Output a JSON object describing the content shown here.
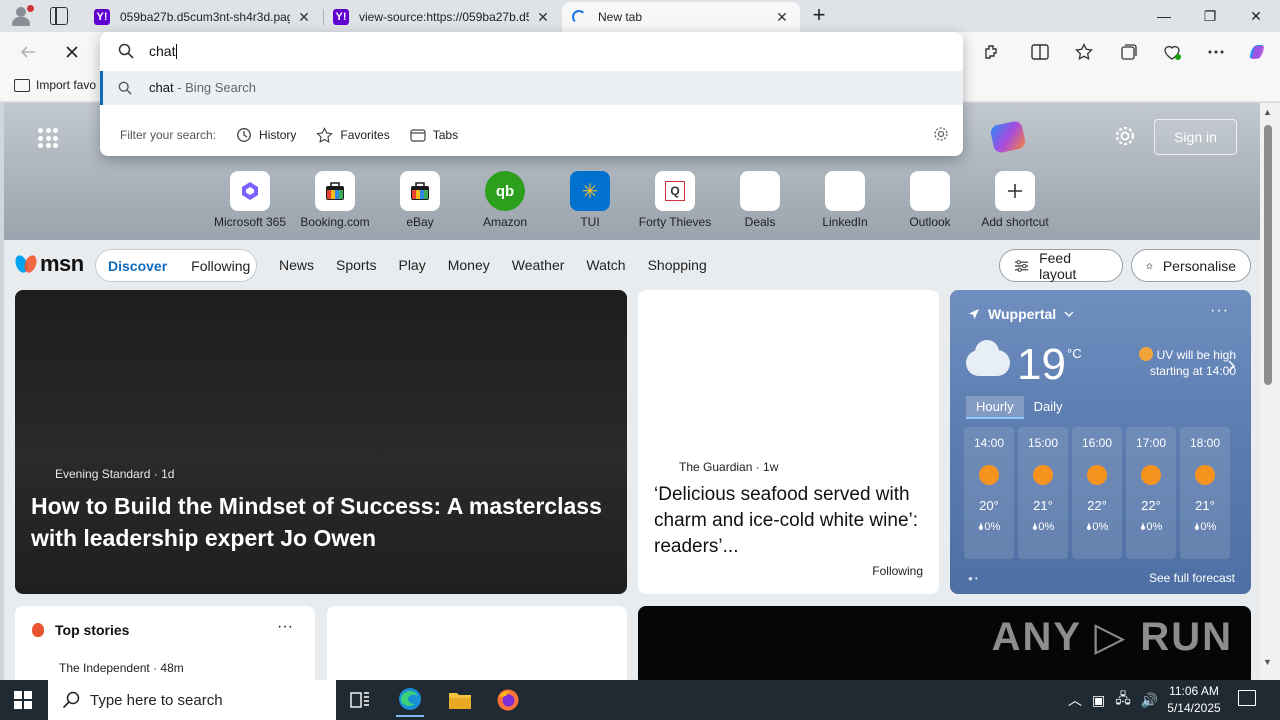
{
  "tabs": [
    {
      "title": "059ba27b.d5cum3nt-sh4r3d.pag",
      "favicon": "yahoo-icon",
      "close": "✕"
    },
    {
      "title": "view-source:https://059ba27b.d5",
      "favicon": "yahoo-icon",
      "close": "✕"
    },
    {
      "title": "New tab",
      "favicon": "loading-icon",
      "close": "✕"
    }
  ],
  "newtab_symbol": "+",
  "window_controls": {
    "minimize": "—",
    "restore": "❐",
    "close": "✕"
  },
  "favorites_bar": {
    "import_label": "Import favo"
  },
  "omnibox": {
    "typed": "chat",
    "suggestion": {
      "query": "chat",
      "source": " - Bing Search"
    },
    "filter_label": "Filter your search:",
    "filters": [
      "History",
      "Favorites",
      "Tabs"
    ]
  },
  "hero": {
    "signin": "Sign in",
    "shortcuts": [
      {
        "label": "Microsoft 365",
        "icon": "microsoft365-icon"
      },
      {
        "label": "Booking.com",
        "icon": "booking-icon"
      },
      {
        "label": "eBay",
        "icon": "ebay-icon"
      },
      {
        "label": "Amazon",
        "icon": "amazon-icon"
      },
      {
        "label": "TUI",
        "icon": "tui-icon"
      },
      {
        "label": "Forty Thieves",
        "icon": "forty-thieves-icon"
      },
      {
        "label": "Deals",
        "icon": "deals-icon"
      },
      {
        "label": "LinkedIn",
        "icon": "linkedin-icon"
      },
      {
        "label": "Outlook",
        "icon": "outlook-icon"
      },
      {
        "label": "Add shortcut",
        "icon": "plus-icon"
      }
    ]
  },
  "nav": {
    "logo": "msn",
    "discover": "Discover",
    "following": "Following",
    "links": [
      "News",
      "Sports",
      "Play",
      "Money",
      "Weather",
      "Watch",
      "Shopping"
    ],
    "feed_layout": "Feed layout",
    "personalise": "Personalise"
  },
  "hero_card": {
    "source": "Evening Standard · 1d",
    "headline": "How to Build the Mindset of Success: A masterclass with leadership expert Jo Owen"
  },
  "article_card": {
    "source": "The Guardian · 1w",
    "headline": "‘Delicious seafood served with charm and ice-cold white wine’: readers’...",
    "follow": "Following"
  },
  "weather": {
    "location": "Wuppertal",
    "temperature": "19",
    "unit": "°C",
    "uv_line1": "UV will be high",
    "uv_line2": "starting at 14:00",
    "tab_hourly": "Hourly",
    "tab_daily": "Daily",
    "hours": [
      {
        "time": "14:00",
        "temp": "20°",
        "precip": "0%"
      },
      {
        "time": "15:00",
        "temp": "21°",
        "precip": "0%"
      },
      {
        "time": "16:00",
        "temp": "22°",
        "precip": "0%"
      },
      {
        "time": "17:00",
        "temp": "22°",
        "precip": "0%"
      },
      {
        "time": "18:00",
        "temp": "21°",
        "precip": "0%"
      }
    ],
    "see_full": "See full forecast"
  },
  "top_stories": {
    "title": "Top stories",
    "source": "The Independent · 48m"
  },
  "watermark": "ANY ▷ RUN",
  "taskbar": {
    "search_placeholder": "Type here to search",
    "time": "11:06 AM",
    "date": "5/14/2025"
  },
  "colors": {
    "accent": "#0f6cbd",
    "yahoo": "#5f01d1",
    "taskbar": "#202a33"
  }
}
